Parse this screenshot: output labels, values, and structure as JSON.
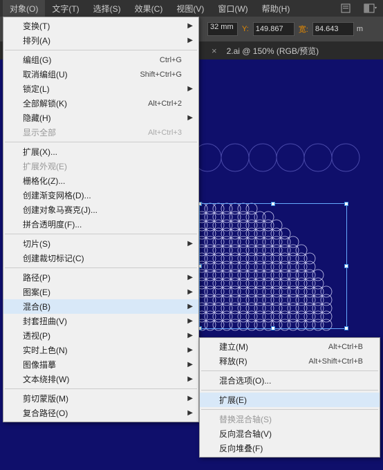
{
  "menubar": {
    "items": [
      "对象(O)",
      "文字(T)",
      "选择(S)",
      "效果(C)",
      "视图(V)",
      "窗口(W)",
      "帮助(H)"
    ]
  },
  "toolbar": {
    "x_suffix": "32 mm",
    "y_label": "Y:",
    "y_value": "149.867",
    "w_label": "宽:",
    "w_value": "84.643",
    "h_suffix": "m"
  },
  "tab": {
    "title": "2.ai @ 150% (RGB/预览)"
  },
  "menu": [
    {
      "label": "变换(T)",
      "arrow": true
    },
    {
      "label": "排列(A)",
      "arrow": true
    },
    {
      "sep": true
    },
    {
      "label": "编组(G)",
      "shortcut": "Ctrl+G"
    },
    {
      "label": "取消编组(U)",
      "shortcut": "Shift+Ctrl+G"
    },
    {
      "label": "锁定(L)",
      "arrow": true
    },
    {
      "label": "全部解锁(K)",
      "shortcut": "Alt+Ctrl+2"
    },
    {
      "label": "隐藏(H)",
      "arrow": true
    },
    {
      "label": "显示全部",
      "shortcut": "Alt+Ctrl+3",
      "disabled": true
    },
    {
      "sep": true
    },
    {
      "label": "扩展(X)..."
    },
    {
      "label": "扩展外观(E)",
      "disabled": true
    },
    {
      "label": "栅格化(Z)..."
    },
    {
      "label": "创建渐变网格(D)..."
    },
    {
      "label": "创建对象马赛克(J)..."
    },
    {
      "label": "拼合透明度(F)..."
    },
    {
      "sep": true
    },
    {
      "label": "切片(S)",
      "arrow": true
    },
    {
      "label": "创建裁切标记(C)"
    },
    {
      "sep": true
    },
    {
      "label": "路径(P)",
      "arrow": true
    },
    {
      "label": "图案(E)",
      "arrow": true
    },
    {
      "label": "混合(B)",
      "arrow": true,
      "hover": true
    },
    {
      "label": "封套扭曲(V)",
      "arrow": true
    },
    {
      "label": "透视(P)",
      "arrow": true
    },
    {
      "label": "实时上色(N)",
      "arrow": true
    },
    {
      "label": "图像描摹",
      "arrow": true
    },
    {
      "label": "文本绕排(W)",
      "arrow": true
    },
    {
      "sep": true
    },
    {
      "label": "剪切蒙版(M)",
      "arrow": true
    },
    {
      "label": "复合路径(O)",
      "arrow": true
    }
  ],
  "submenu": [
    {
      "label": "建立(M)",
      "shortcut": "Alt+Ctrl+B"
    },
    {
      "label": "释放(R)",
      "shortcut": "Alt+Shift+Ctrl+B"
    },
    {
      "sep": true
    },
    {
      "label": "混合选项(O)..."
    },
    {
      "sep": true
    },
    {
      "label": "扩展(E)",
      "hover": true
    },
    {
      "sep": true
    },
    {
      "label": "替换混合轴(S)",
      "disabled": true
    },
    {
      "label": "反向混合轴(V)"
    },
    {
      "label": "反向堆叠(F)"
    }
  ]
}
